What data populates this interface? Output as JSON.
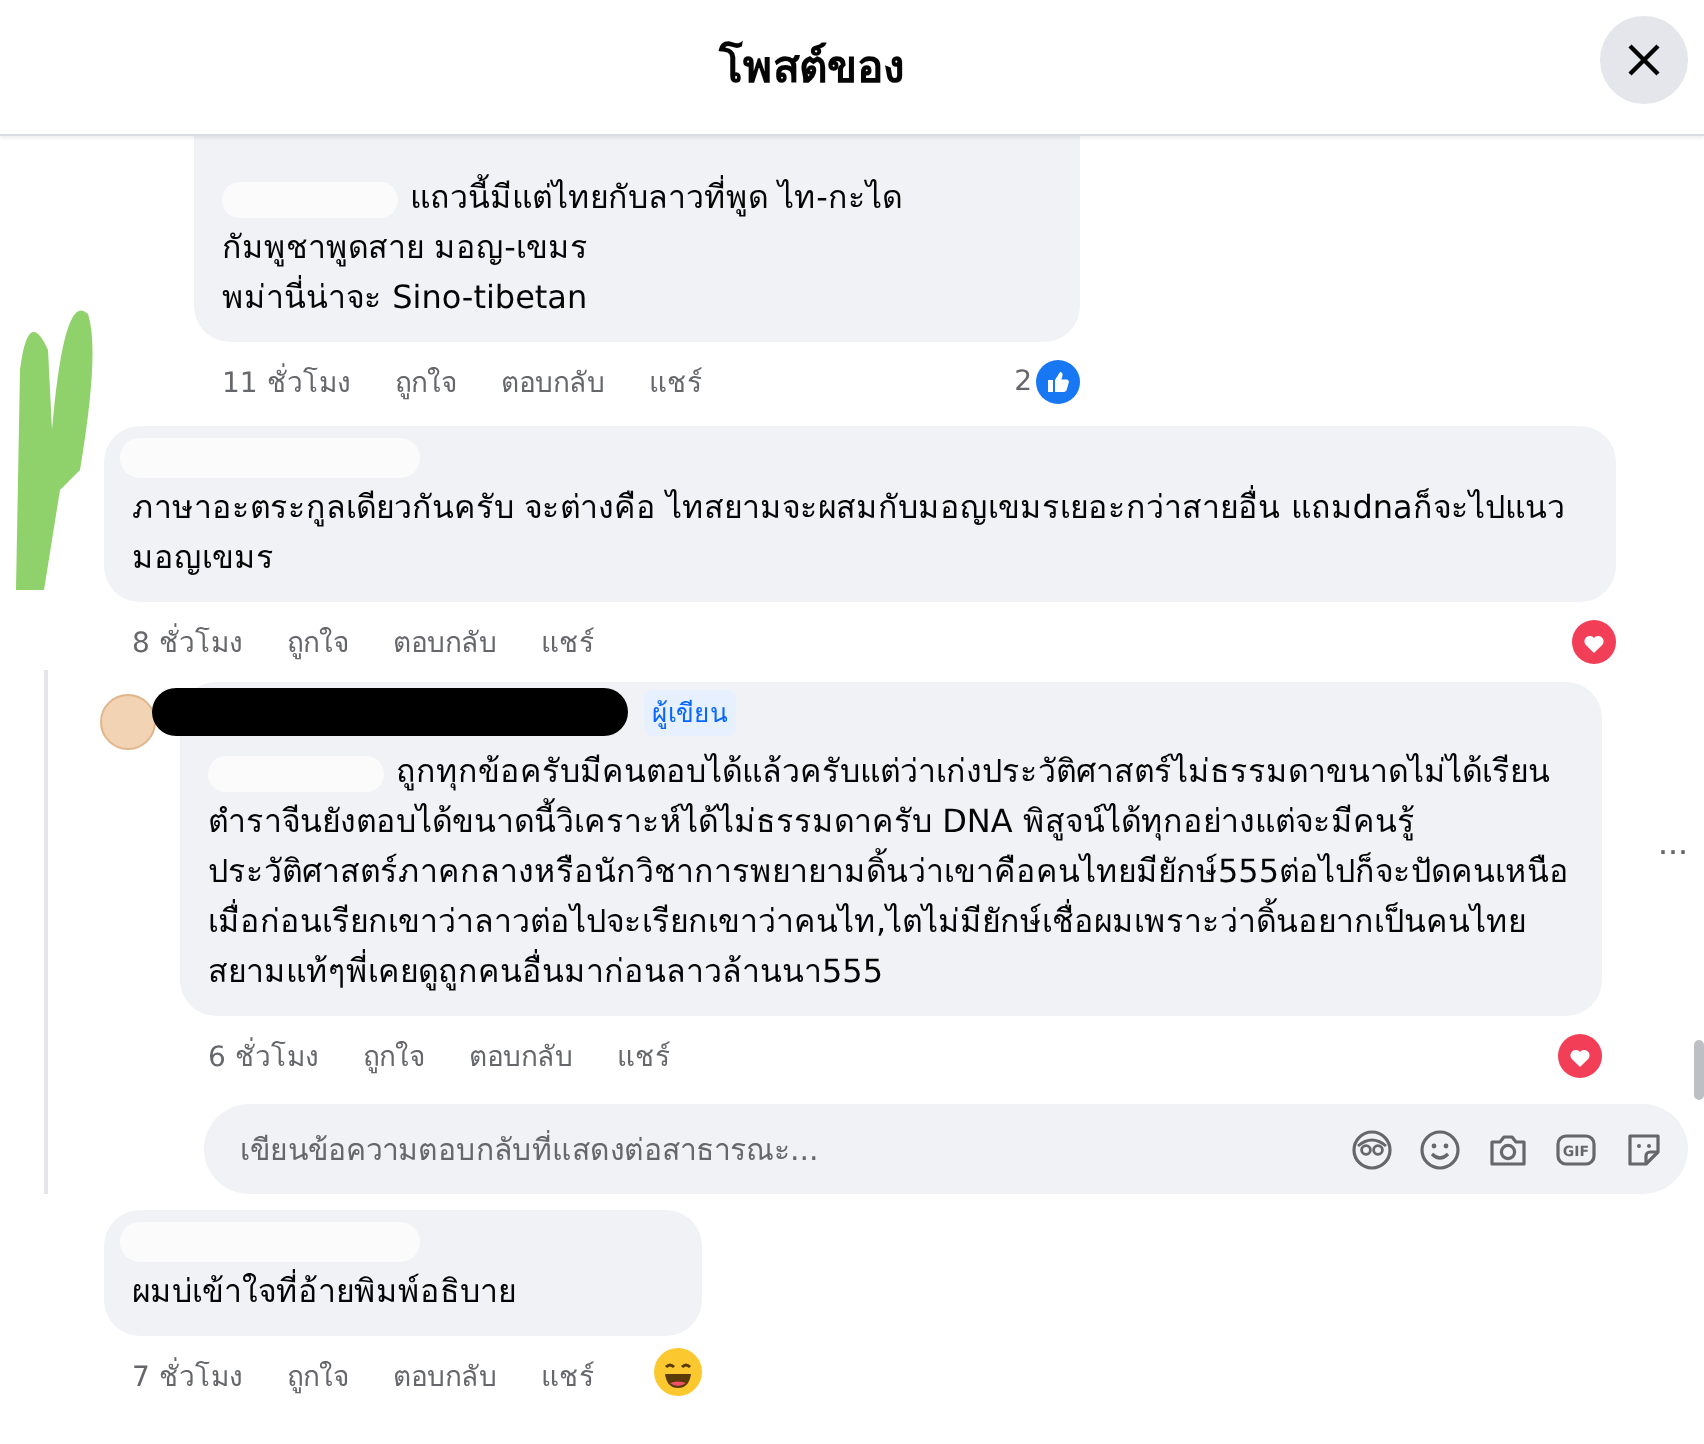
{
  "header": {
    "title": "โพสต์ของ"
  },
  "earlier_reply": {
    "masks": [
      {
        "kind": "whiteout_inline"
      }
    ],
    "lines": [
      "แถวนี้มีแต่ไทยกับลาวที่พูด ไท-กะได",
      "กัมพูชาพูดสาย มอญ-เขมร",
      "พม่านี่น่าจะ Sino-tibetan"
    ],
    "time": "11 ชั่วโมง",
    "actions": [
      "ถูกใจ",
      "ตอบกลับ",
      "แชร์"
    ],
    "reaction": {
      "kind": "like",
      "count": "2"
    }
  },
  "comments": [
    {
      "masks": [
        {
          "kind": "whiteout_line"
        }
      ],
      "lines": [
        "ภาษาอะตระกูลเดียวกันครับ จะต่างคือ ไทสยามจะผสมกับมอญเขมรเยอะกว่าสายอื่น แถมdnaก็จะไปแนวมอญเขมร"
      ],
      "time": "8 ชั่วโมง",
      "actions": [
        "ถูกใจ",
        "ตอบกลับ",
        "แชร์"
      ],
      "reaction": {
        "kind": "love"
      },
      "replies": [
        {
          "author": {
            "kind": "blackout"
          },
          "masks": [
            {
              "kind": "whiteout_inline"
            }
          ],
          "author_badge": "ผู้เขียน",
          "lines": [
            "ถูกทุกข้อครับมีคนตอบได้แล้วครับแต่ว่าเก่งประวัติศาสตร์ไม่ธรรมดาขนาดไม่ได้เรียนตำราจีนยังตอบได้ขนาดนี้วิเคราะห์ได้ไม่ธรรมดาครับ DNA พิสูจน์ได้ทุกอย่างแต่จะมีคนรู้ประวัติศาสตร์ภาคกลางหรือนักวิชาการพยายามดิ้นว่าเขาคือคนไทยมียักษ์555ต่อไปก็จะปัดคนเหนือเมื่อก่อนเรียกเขาว่าลาวต่อไปจะเรียกเขาว่าคนไท,ไตไม่มียักษ์เชื่อผมเพราะว่าดิ้นอยากเป็นคนไทยสยามแท้ๆพี่เคยดูถูกคนอื่นมาก่อนลาวล้านนา555"
          ],
          "time": "6 ชั่วโมง",
          "actions": [
            "ถูกใจ",
            "ตอบกลับ",
            "แชร์"
          ],
          "reaction": {
            "kind": "love"
          },
          "more": "..."
        }
      ],
      "reply_box": {
        "placeholder": "เขียนข้อความตอบกลับที่แสดงต่อสาธารณะ...",
        "gif_label": "GIF"
      }
    },
    {
      "masks": [
        {
          "kind": "whiteout_line"
        }
      ],
      "lines": [
        "ผมบ่เข้าใจที่อ้ายพิมพ์อธิบาย"
      ],
      "time": "7 ชั่วโมง",
      "actions": [
        "ถูกใจ",
        "ตอบกลับ",
        "แชร์"
      ],
      "reaction": {
        "kind": "haha"
      }
    }
  ]
}
